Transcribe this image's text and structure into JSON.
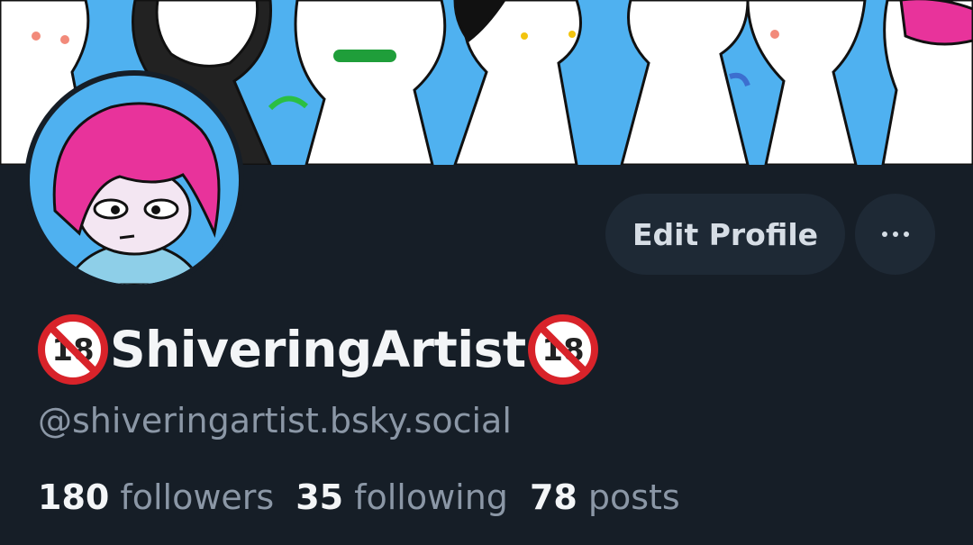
{
  "profile": {
    "display_name": "ShiveringArtist",
    "name_prefix_emoji": "no-one-under-eighteen-icon",
    "name_suffix_emoji": "no-one-under-eighteen-icon",
    "badge_text": "18",
    "handle": "@shiveringartist.bsky.social"
  },
  "actions": {
    "edit_label": "Edit Profile",
    "more_icon": "ellipsis-icon"
  },
  "stats": {
    "followers_count": "180",
    "followers_label": "followers",
    "following_count": "35",
    "following_label": "following",
    "posts_count": "78",
    "posts_label": "posts"
  },
  "colors": {
    "background": "#161e27",
    "banner_sky": "#4fb1f0",
    "avatar_hair": "#e8339b",
    "button_bg": "#1e2935",
    "muted_text": "#8b97a6"
  }
}
